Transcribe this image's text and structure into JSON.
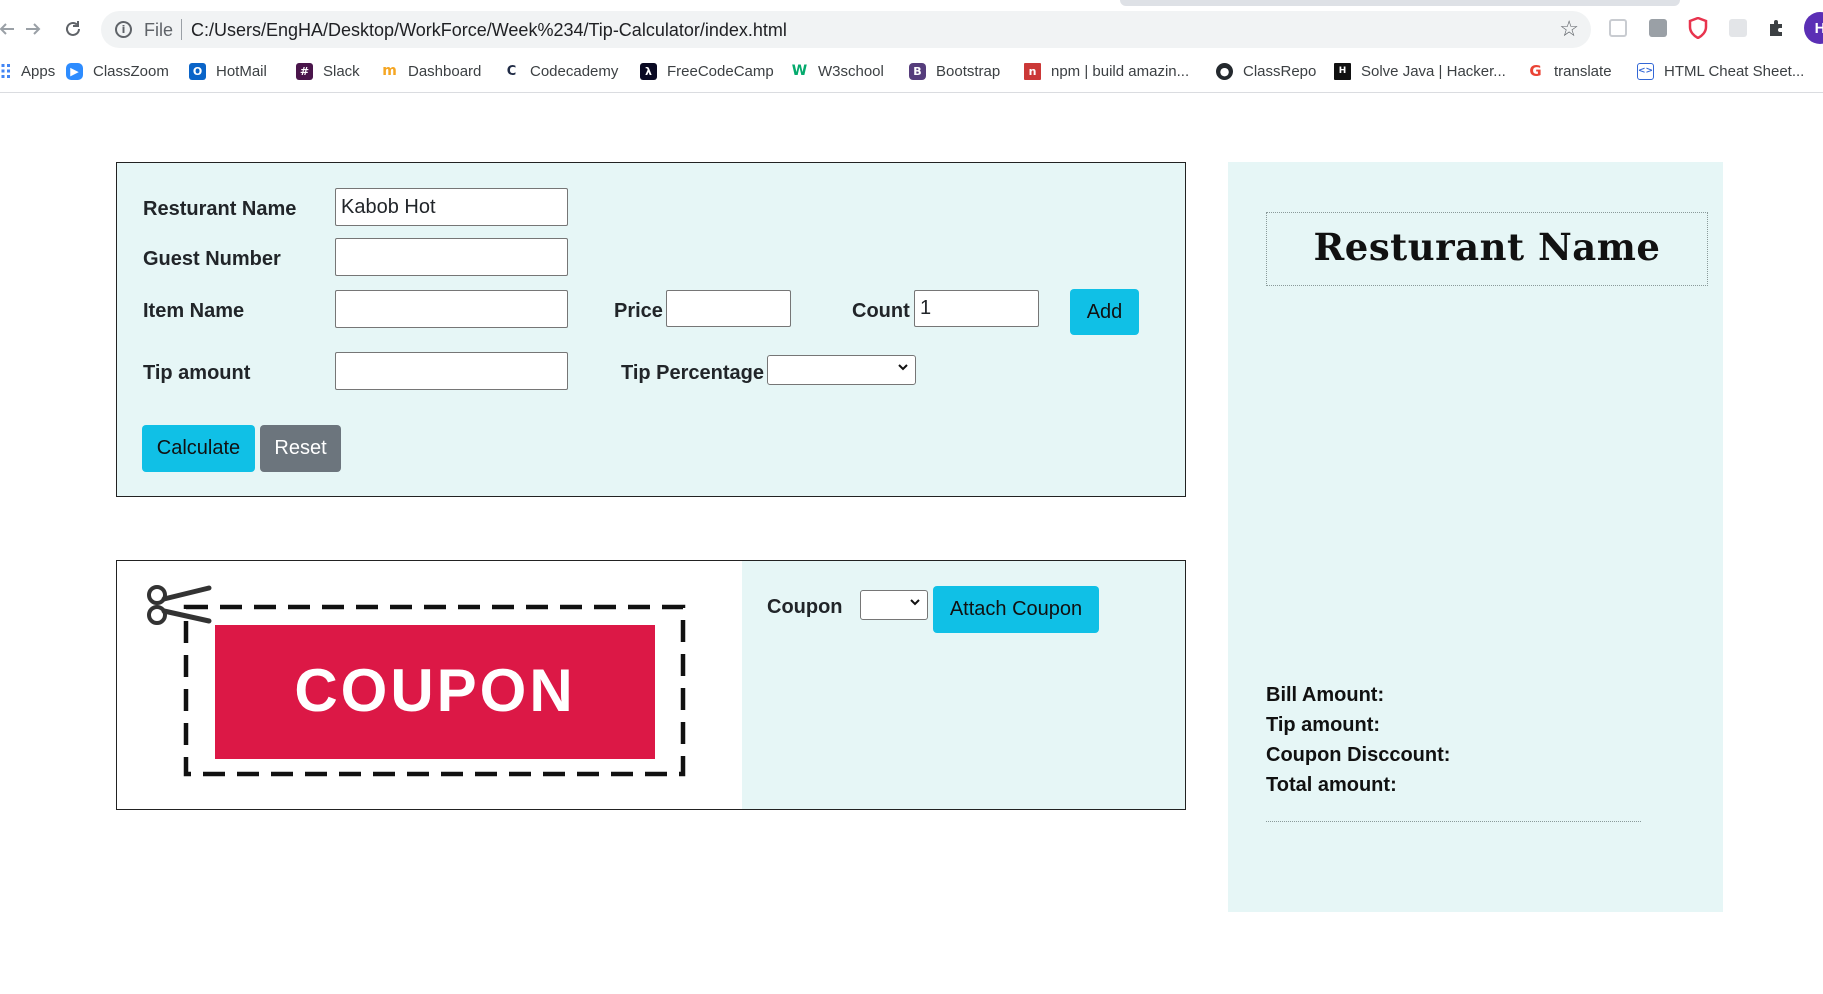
{
  "browser": {
    "scheme": "File",
    "url": "C:/Users/EngHA/Desktop/WorkForce/Week%234/Tip-Calculator/index.html",
    "avatar_letter": "H",
    "bookmarks": [
      {
        "label": "Apps",
        "icon": "apps-grid-icon",
        "color": "#4285f4"
      },
      {
        "label": "ClassZoom",
        "icon": "zoom-icon",
        "color": "#2d8cff"
      },
      {
        "label": "HotMail",
        "icon": "outlook-icon",
        "color": "#0a64c8"
      },
      {
        "label": "Slack",
        "icon": "slack-icon",
        "color": "#4a154b"
      },
      {
        "label": "Dashboard",
        "icon": "dashboard-icon",
        "color": "#f5a623"
      },
      {
        "label": "Codecademy",
        "icon": "codecademy-icon",
        "color": "#1f2a44"
      },
      {
        "label": "FreeCodeCamp",
        "icon": "freecodecamp-icon",
        "color": "#0a0a23"
      },
      {
        "label": "W3school",
        "icon": "w3schools-icon",
        "color": "#04aa6d"
      },
      {
        "label": "Bootstrap",
        "icon": "bootstrap-icon",
        "color": "#563d7c"
      },
      {
        "label": "npm | build amazin...",
        "icon": "npm-icon",
        "color": "#cb3837"
      },
      {
        "label": "ClassRepo",
        "icon": "github-icon",
        "color": "#24292e"
      },
      {
        "label": "Solve Java | Hacker...",
        "icon": "hackerrank-icon",
        "color": "#111111"
      },
      {
        "label": "translate",
        "icon": "google-icon",
        "color": "#ea4335"
      },
      {
        "label": "HTML Cheat Sheet...",
        "icon": "code-icon",
        "color": "#3367d6"
      }
    ]
  },
  "form": {
    "restaurant_label": "Resturant Name",
    "restaurant_value": "Kabob Hot",
    "guest_label": "Guest Number",
    "guest_value": "",
    "item_label": "Item Name",
    "item_value": "",
    "price_label": "Price",
    "price_value": "",
    "count_label": "Count",
    "count_value": "1",
    "add_label": "Add",
    "tip_amount_label": "Tip amount",
    "tip_amount_value": "",
    "tip_percentage_label": "Tip Percentage",
    "tip_percentage_value": "",
    "calculate_label": "Calculate",
    "reset_label": "Reset"
  },
  "coupon": {
    "image_text": "COUPON",
    "image_color": "#dc1846",
    "label": "Coupon",
    "selected": "",
    "attach_label": "Attach Coupon"
  },
  "receipt": {
    "title": "Resturant Name",
    "bill_label": "Bill Amount:",
    "tip_label": "Tip amount:",
    "coupon_label": "Coupon Disccount:",
    "total_label": "Total amount:"
  },
  "colors": {
    "panel_bg": "#e6f6f6",
    "info_button": "#10c0e6",
    "secondary_button": "#6c757d"
  }
}
